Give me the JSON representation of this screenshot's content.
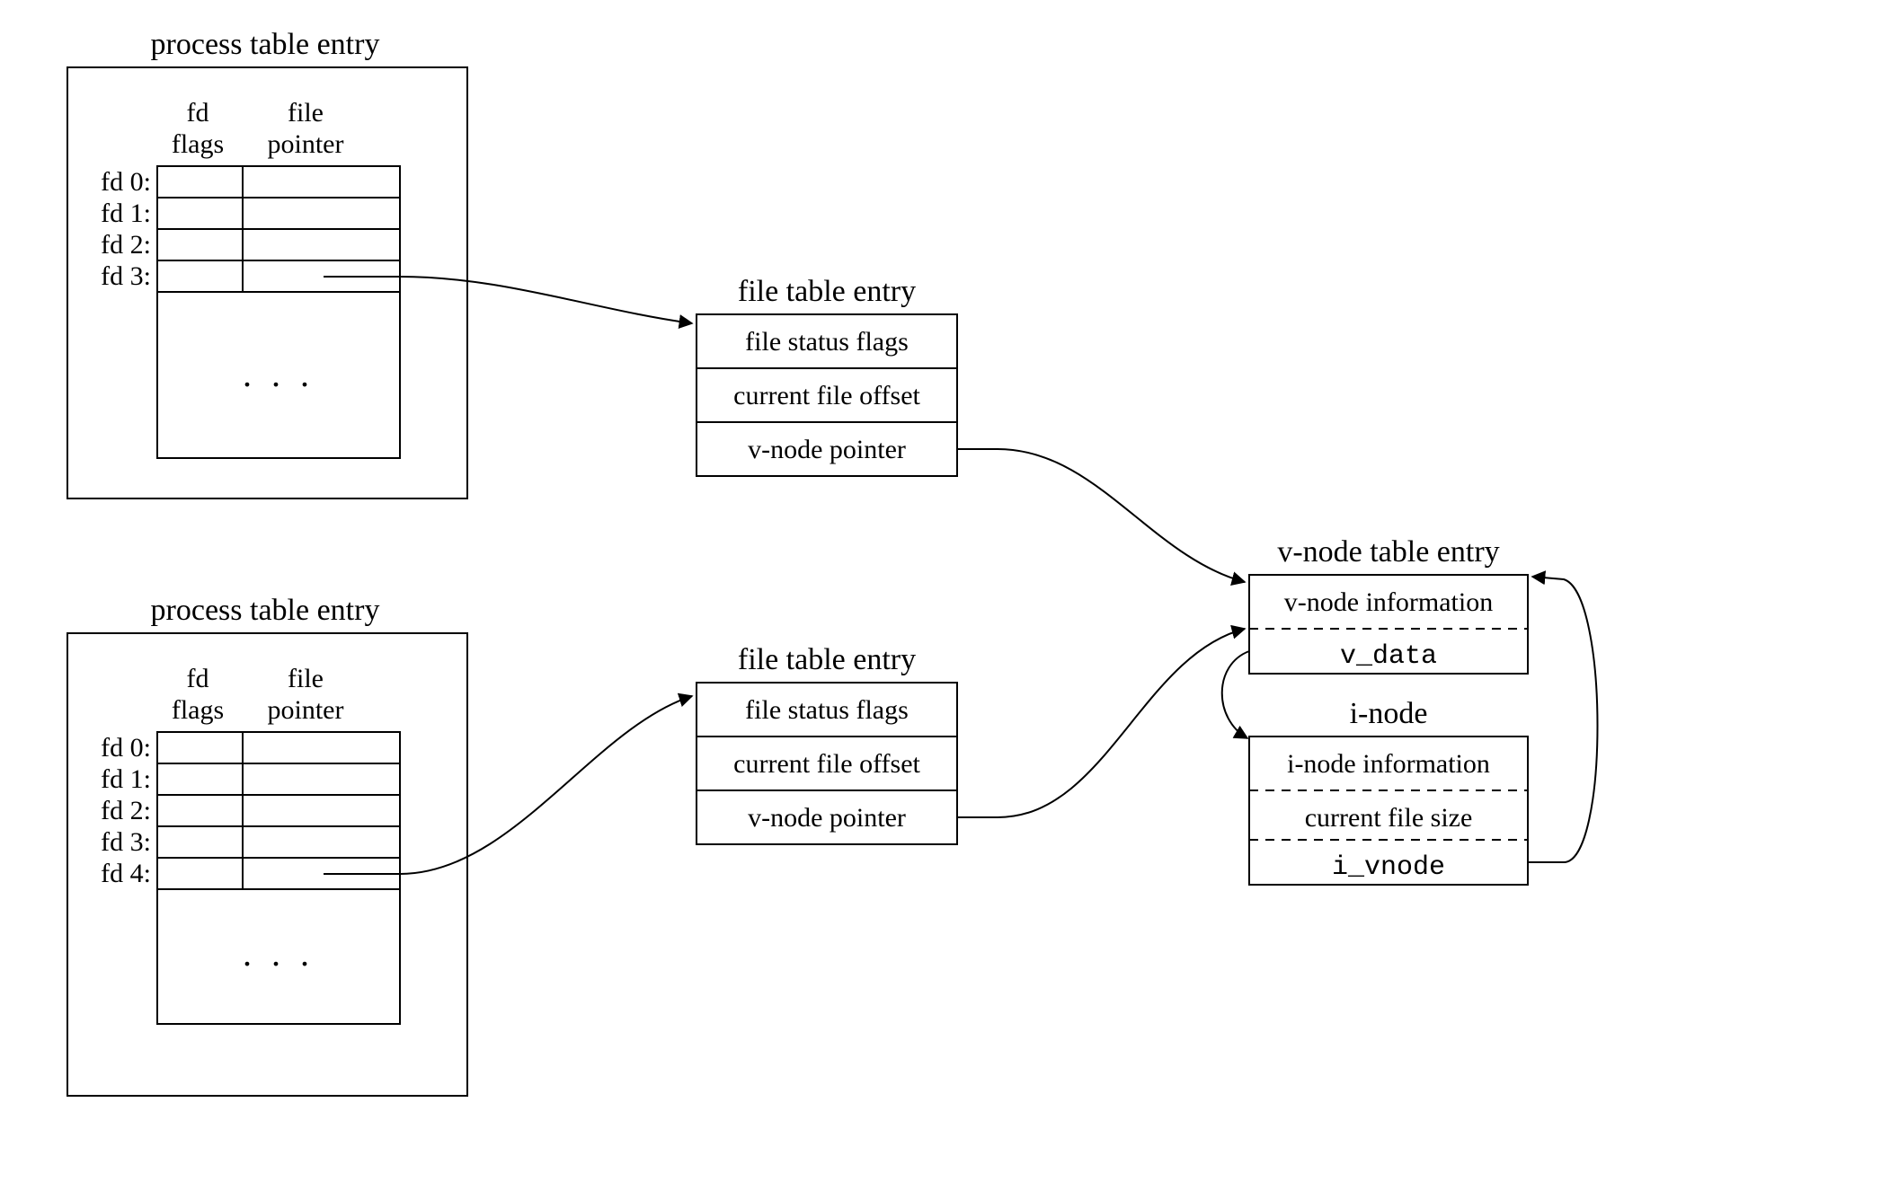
{
  "proc1": {
    "title": "process table entry",
    "col1_top": "fd",
    "col1_bot": "flags",
    "col2_top": "file",
    "col2_bot": "pointer",
    "rows": [
      "fd 0:",
      "fd 1:",
      "fd 2:",
      "fd 3:"
    ],
    "ellipsis": ". . ."
  },
  "proc2": {
    "title": "process table entry",
    "col1_top": "fd",
    "col1_bot": "flags",
    "col2_top": "file",
    "col2_bot": "pointer",
    "rows": [
      "fd 0:",
      "fd 1:",
      "fd 2:",
      "fd 3:",
      "fd 4:"
    ],
    "ellipsis": ". . ."
  },
  "file1": {
    "title": "file table entry",
    "r1": "file status flags",
    "r2": "current file offset",
    "r3": "v-node pointer"
  },
  "file2": {
    "title": "file table entry",
    "r1": "file status flags",
    "r2": "current file offset",
    "r3": "v-node pointer"
  },
  "vnode": {
    "title": "v-node table entry",
    "r1": "v-node information",
    "r2": "v_data"
  },
  "inode": {
    "title": "i-node",
    "r1": "i-node information",
    "r2": "current file size",
    "r3": "i_vnode"
  }
}
